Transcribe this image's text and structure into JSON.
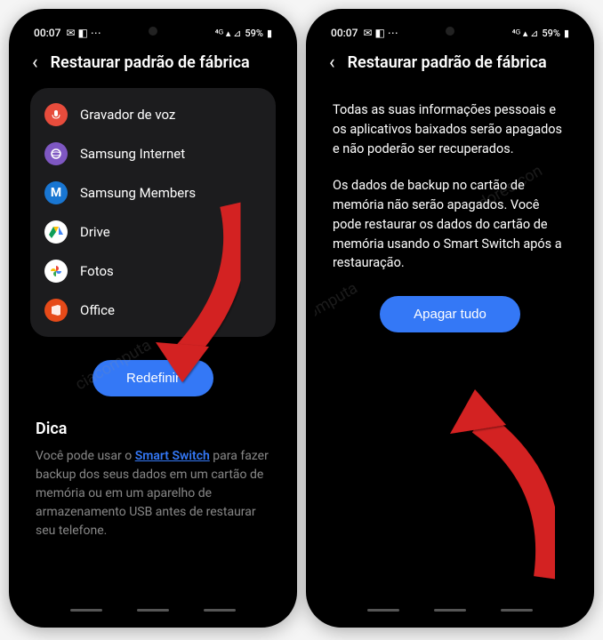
{
  "status": {
    "time": "00:07",
    "battery": "59%"
  },
  "header": {
    "title": "Restaurar padrão de fábrica"
  },
  "apps": [
    {
      "label": "Gravador de voz"
    },
    {
      "label": "Samsung Internet"
    },
    {
      "label": "Samsung Members"
    },
    {
      "label": "Drive"
    },
    {
      "label": "Fotos"
    },
    {
      "label": "Office"
    }
  ],
  "buttons": {
    "reset": "Redefinir",
    "erase": "Apagar tudo"
  },
  "tip": {
    "title": "Dica",
    "prefix": "Você pode usar o ",
    "link": "Smart Switch",
    "suffix": " para fazer backup dos seus dados em um cartão de memória ou em um aparelho de armazenamento USB antes de restaurar seu telefone."
  },
  "info": {
    "p1": "Todas as suas informações pessoais e os aplicativos baixados serão apagados e não poderão ser recuperados.",
    "p2": "Os dados de backup no cartão de memória não serão apagados. Você pode restaurar os dados do cartão de memória usando o Smart Switch após a restauração."
  }
}
